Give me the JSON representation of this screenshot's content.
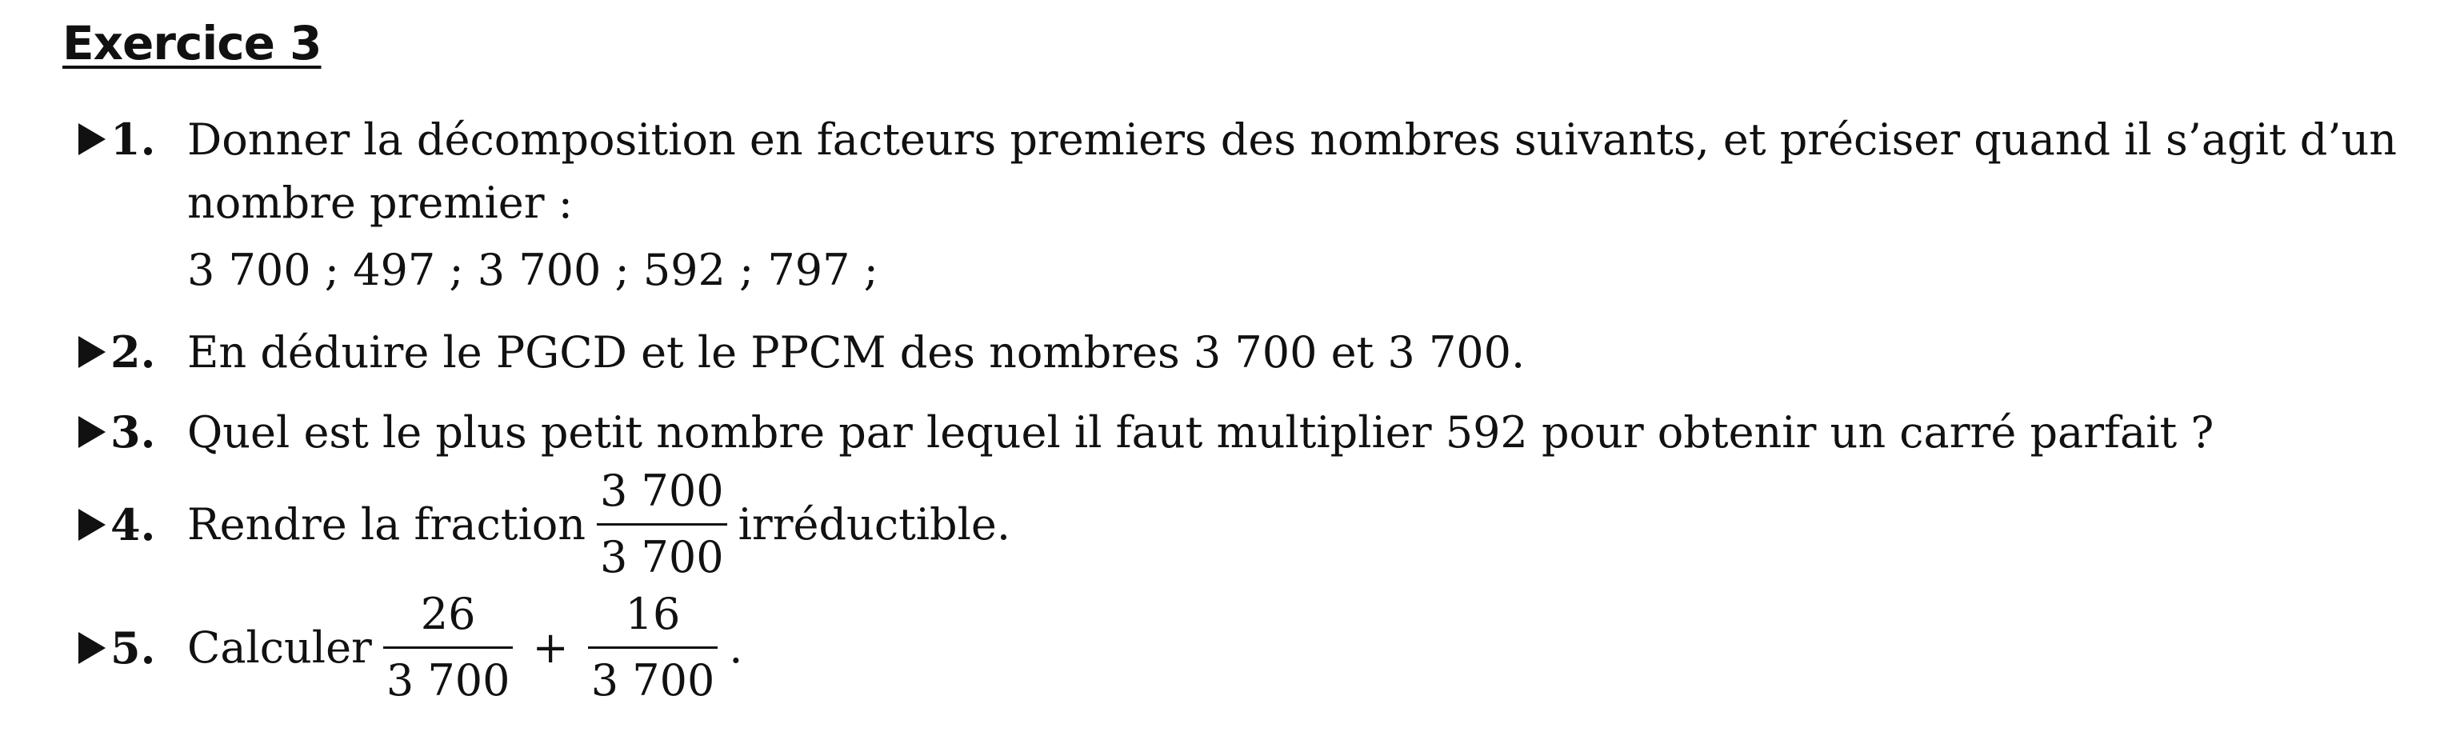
{
  "title": "Exercice 3",
  "items": [
    {
      "marker": "1.",
      "line1": "Donner la décomposition en facteurs premiers des nombres suivants, et préciser quand il s’agit d’un",
      "line2": "nombre premier :",
      "line3": "3 700 ; 497 ; 3 700 ; 592 ; 797 ;"
    },
    {
      "marker": "2.",
      "text": "En déduire le PGCD et le PPCM des nombres 3 700 et 3 700."
    },
    {
      "marker": "3.",
      "text": "Quel est le plus petit nombre par lequel il faut multiplier 592 pour obtenir un carré parfait ?"
    },
    {
      "marker": "4.",
      "before": "Rendre la fraction",
      "numerator": "3 700",
      "denominator": "3 700",
      "after": "irréductible."
    },
    {
      "marker": "5.",
      "before": "Calculer",
      "frac1_num": "26",
      "frac1_den": "3 700",
      "operator": "+",
      "frac2_num": "16",
      "frac2_den": "3 700",
      "end": "."
    }
  ]
}
